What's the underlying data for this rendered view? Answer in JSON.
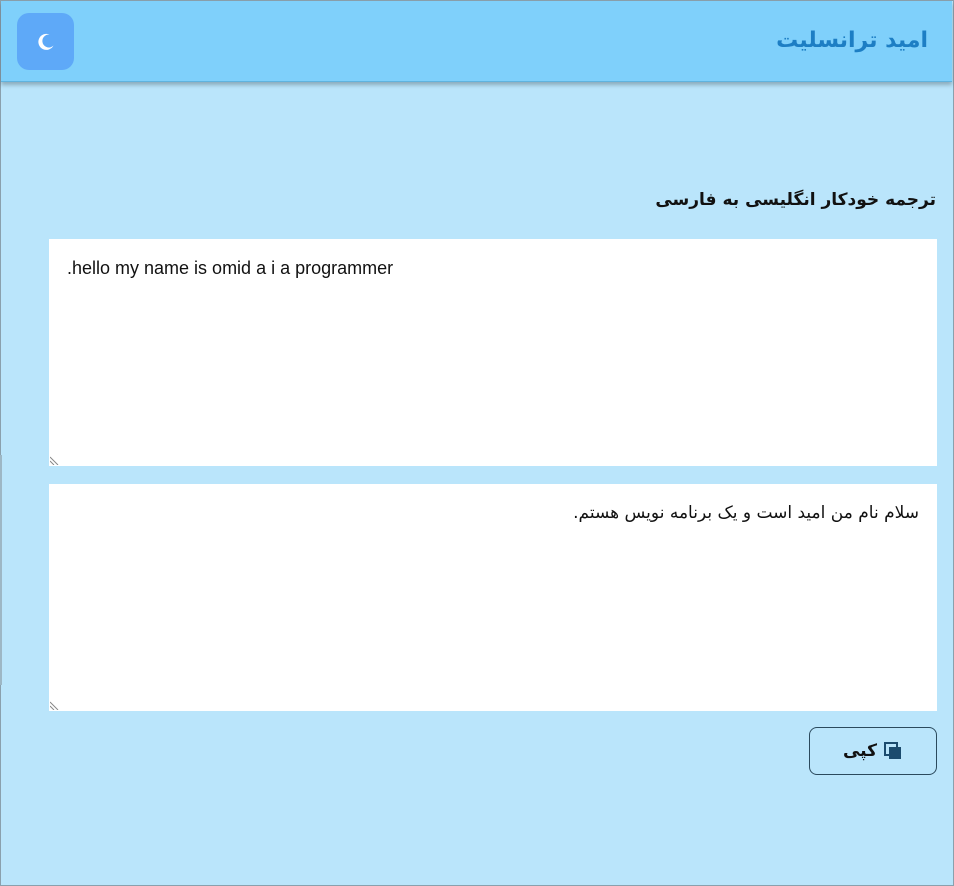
{
  "app": {
    "title": "امید ترانسلیت",
    "theme_toggle_icon": "moon-icon"
  },
  "translator": {
    "label": "ترجمه خودکار انگلیسی به فارسی",
    "source_text": ".hello my name is omid a i a programmer",
    "target_text": "سلام نام من امید است و یک برنامه نویس هستم."
  },
  "copy_button": {
    "label": "کپی",
    "icon": "copy-icon"
  },
  "colors": {
    "background": "#bae5fb",
    "header": "#7fd0fb",
    "title": "#1d7ec4",
    "toggle": "#5ea9f8",
    "copy_icon": "#1b4b6e"
  }
}
